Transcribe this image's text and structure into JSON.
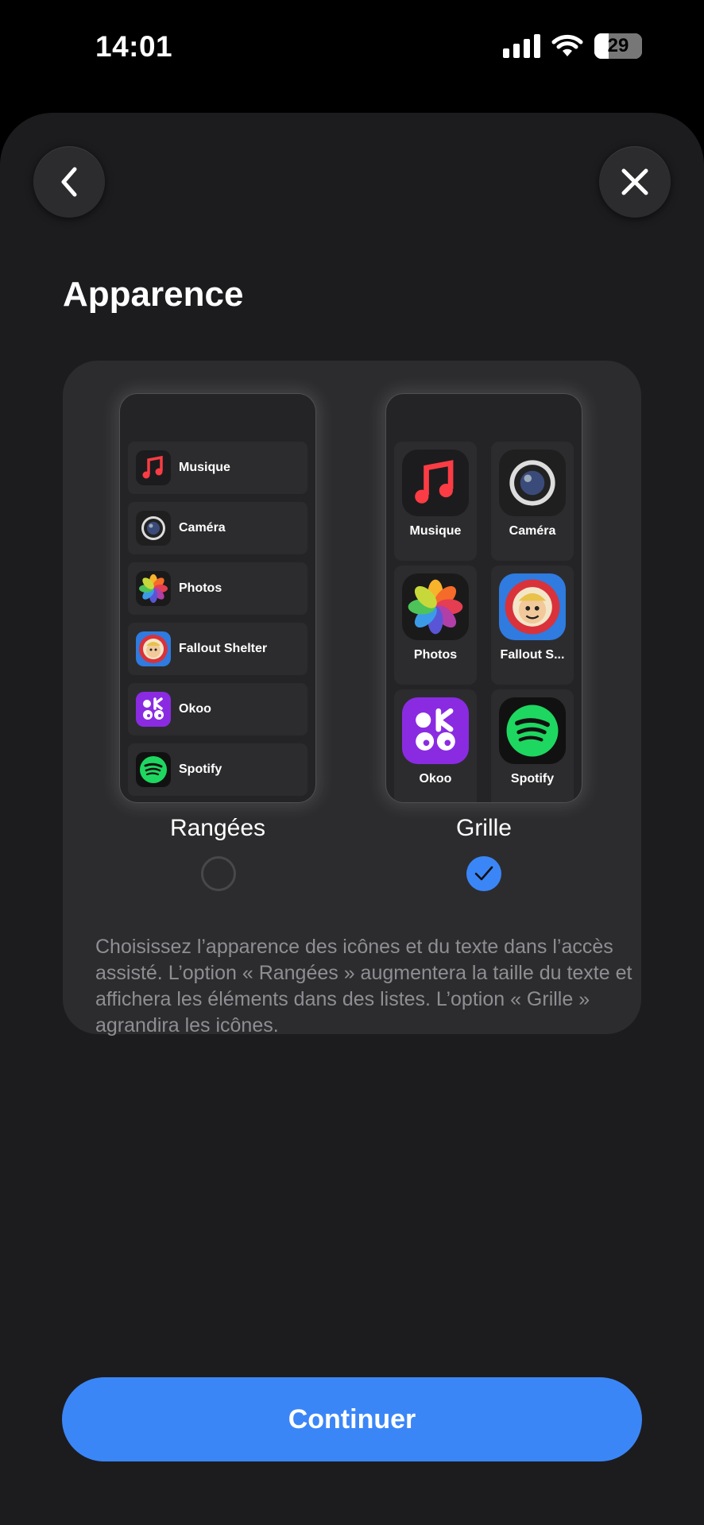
{
  "status": {
    "time": "14:01",
    "battery": "29",
    "icons": [
      "signal-icon",
      "wifi-icon",
      "battery-icon"
    ]
  },
  "header": {
    "back": "chevron-left-icon",
    "close": "close-icon"
  },
  "title": "Apparence",
  "options": {
    "rows": {
      "label": "Rangées",
      "selected": false,
      "items": [
        "Musique",
        "Caméra",
        "Photos",
        "Fallout Shelter",
        "Okoo",
        "Spotify"
      ]
    },
    "grid": {
      "label": "Grille",
      "selected": true,
      "items": [
        "Musique",
        "Caméra",
        "Photos",
        "Fallout S...",
        "Okoo",
        "Spotify"
      ]
    }
  },
  "description": "Choisissez l’apparence des icônes et du texte dans l’accès assisté. L’option « Rangées » augmentera la taille du texte et affichera les éléments dans des listes. L’option « Grille » agrandira les icônes.",
  "continue_label": "Continuer",
  "colors": {
    "accent": "#3b86f7",
    "sheet": "#1c1c1e",
    "card": "#2c2c2e",
    "music": "#fc3c44",
    "spotify": "#1ed760",
    "okoo": "#8a2be2"
  }
}
